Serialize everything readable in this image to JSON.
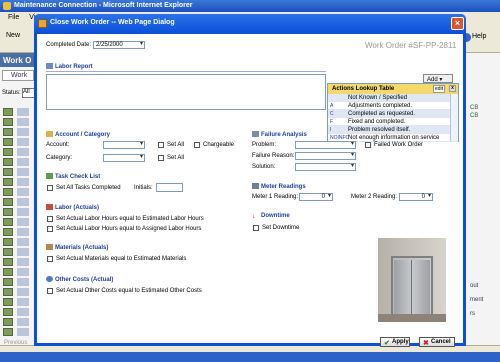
{
  "browser": {
    "title": "Maintenance Connection - Microsoft Internet Explorer",
    "menu": [
      "File",
      "View"
    ],
    "toolbar_new": "New",
    "toolbar_help": "Help",
    "left_header": "Work O",
    "left_tab": "Work",
    "status_label": "Status:",
    "status_value": "All",
    "previous": "Previous",
    "right_fragments": [
      "CB",
      "CB",
      "out",
      "ment",
      "rs"
    ]
  },
  "dialog": {
    "title": "Close Work Order -- Web Page Dialog",
    "work_order": "Work Order #SF-PP-2811",
    "completed_date_label": "Completed Date:",
    "completed_date_value": "2/25/2000"
  },
  "labor_report": {
    "title": "Labor Report",
    "add_label": "Add"
  },
  "lookup": {
    "title": "Actions Lookup Table",
    "edit_label": "edit",
    "close_label": "x",
    "rows": [
      {
        "code": "",
        "desc": "Not Known / Specified"
      },
      {
        "code": "A",
        "desc": "Adjustments completed."
      },
      {
        "code": "C",
        "desc": "Completed as requested."
      },
      {
        "code": "F",
        "desc": "Fixed and completed."
      },
      {
        "code": "I",
        "desc": "Problem resolved itself."
      },
      {
        "code": "NOINFO",
        "desc": "Not enough information on service"
      }
    ]
  },
  "account": {
    "title": "Account / Category",
    "account_label": "Account:",
    "set_all_1": "Set All",
    "chargeable": "Chargeable",
    "category_label": "Category:",
    "set_all_2": "Set All"
  },
  "failure": {
    "title": "Failure Analysis",
    "problem_label": "Problem:",
    "failed_wo": "Failed Work Order",
    "reason_label": "Failure Reason:",
    "solution_label": "Solution:"
  },
  "tasks": {
    "title": "Task Check List",
    "set_all_tasks": "Set All Tasks Completed",
    "initials_label": "Initials:"
  },
  "labor_actuals": {
    "title": "Labor (Actuals)",
    "opt1": "Set Actual Labor Hours equal to Estimated Labor Hours",
    "opt2": "Set Actual Labor Hours equal to Assigned Labor Hours"
  },
  "meter": {
    "title": "Meter Readings",
    "meter1_label": "Meter 1 Reading:",
    "meter1_value": "0",
    "meter2_label": "Meter 2 Reading:",
    "meter2_value": "0"
  },
  "downtime": {
    "title": "Downtime",
    "set_downtime": "Set Downtime"
  },
  "materials": {
    "title": "Materials (Actuals)",
    "opt": "Set Actual Materials equal to Estimated Materials"
  },
  "other_costs": {
    "title": "Other Costs (Actual)",
    "opt": "Set Actual Other Costs equal to Estimated Other Costs"
  },
  "buttons": {
    "apply": "Apply",
    "cancel": "Cancel"
  },
  "colors": {
    "dialog_frame": "#0a50d8",
    "section_title": "#20409a",
    "lookup_header": "#f3d96b"
  }
}
